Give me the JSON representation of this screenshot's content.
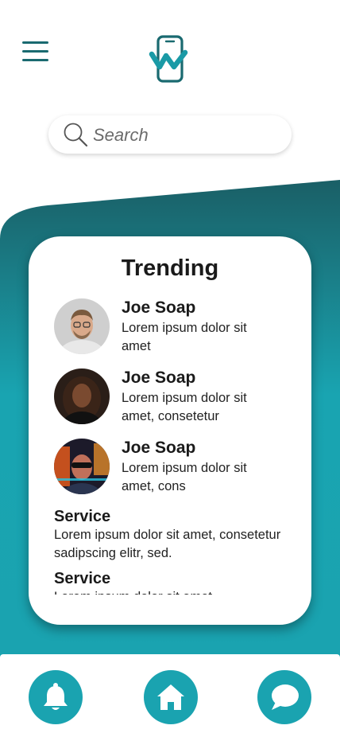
{
  "search": {
    "placeholder": "Search"
  },
  "trending": {
    "title": "Trending",
    "items": [
      {
        "name": "Joe Soap",
        "desc": "Lorem ipsum dolor sit amet"
      },
      {
        "name": "Joe Soap",
        "desc": "Lorem ipsum dolor sit amet, consetetur"
      },
      {
        "name": "Joe Soap",
        "desc": "Lorem ipsum dolor sit amet, cons"
      }
    ],
    "services": [
      {
        "title": "Service",
        "desc": "Lorem ipsum dolor sit amet, consetetur sadipscing elitr, sed."
      },
      {
        "title": "Service",
        "desc": "Lorem ipsum dolor sit amet"
      }
    ]
  },
  "colors": {
    "accent": "#1aa3b0",
    "dark_teal": "#1a5f66",
    "icon_teal": "#1a6a70"
  },
  "icons": {
    "menu": "hamburger-menu-icon",
    "logo": "phone-logo",
    "search": "search-icon",
    "nav": [
      "bell-icon",
      "home-icon",
      "chat-bubble-icon"
    ]
  }
}
